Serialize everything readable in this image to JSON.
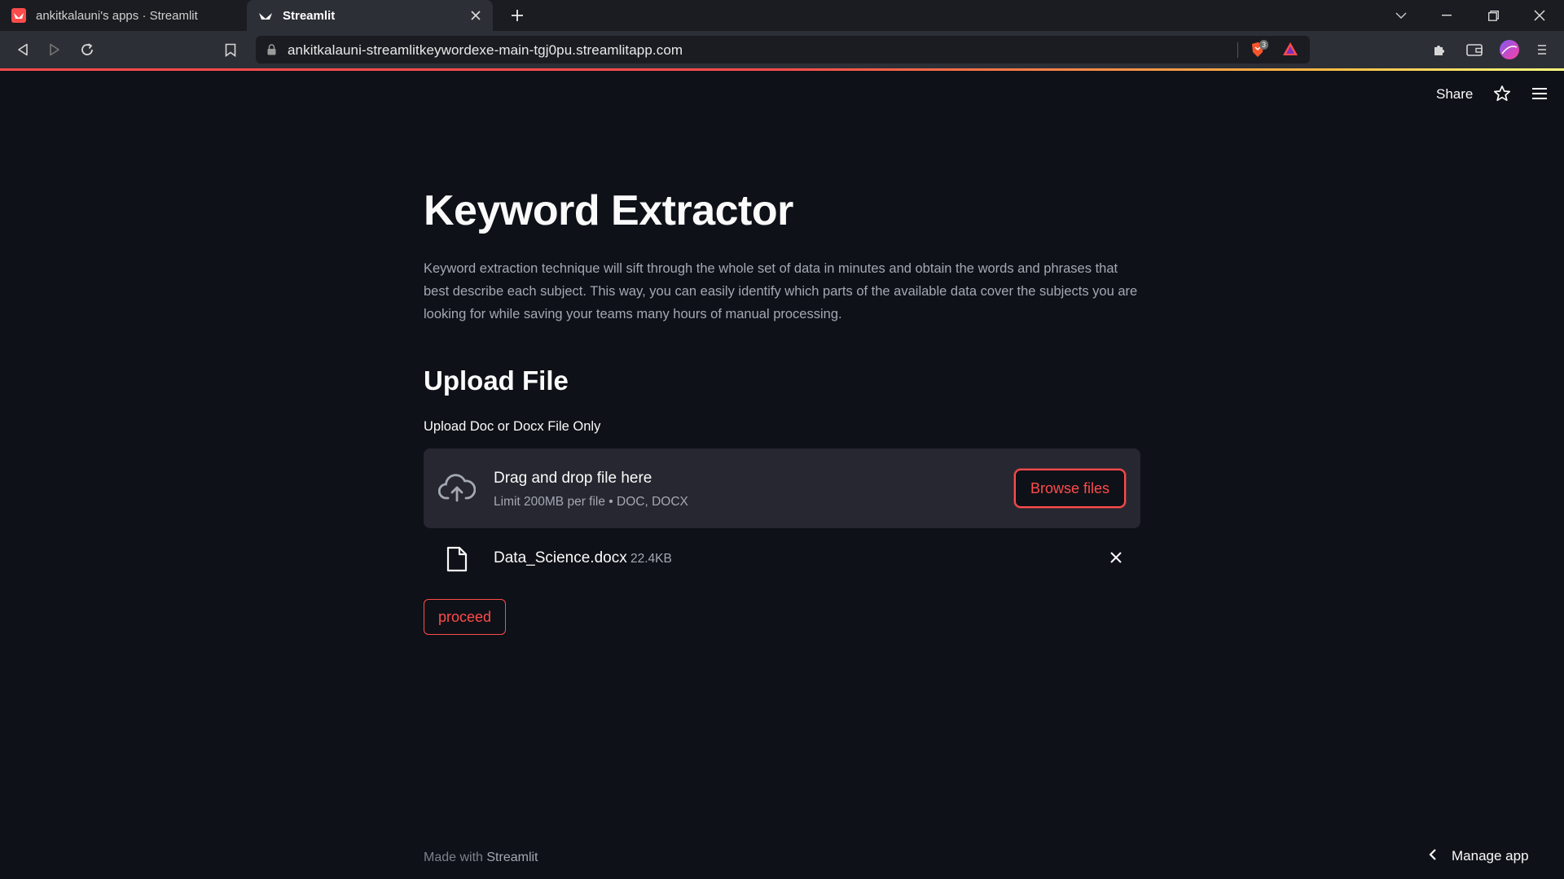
{
  "browser": {
    "tabs": [
      {
        "title": "ankitkalauni's apps · Streamlit"
      },
      {
        "title": "Streamlit"
      }
    ],
    "url": "ankitkalauni-streamlitkeywordexe-main-tgj0pu.streamlitapp.com",
    "shield_count": "3"
  },
  "app_header": {
    "share_label": "Share"
  },
  "main": {
    "title": "Keyword Extractor",
    "description": "Keyword extraction technique will sift through the whole set of data in minutes and obtain the words and phrases that best describe each subject. This way, you can easily identify which parts of the available data cover the subjects you are looking for while saving your teams many hours of manual processing.",
    "section_title": "Upload File",
    "uploader": {
      "label": "Upload Doc or Docx File Only",
      "drop_title": "Drag and drop file here",
      "limit": "Limit 200MB per file • DOC, DOCX",
      "browse_label": "Browse files"
    },
    "file": {
      "name": "Data_Science.docx",
      "size": "22.4KB"
    },
    "proceed_label": "proceed"
  },
  "footer": {
    "made_with": "Made with",
    "brand": "Streamlit"
  },
  "manage_app_label": "Manage app",
  "colors": {
    "background": "#0e1117",
    "accent": "#ff4b4b",
    "dropzone": "#262730"
  }
}
